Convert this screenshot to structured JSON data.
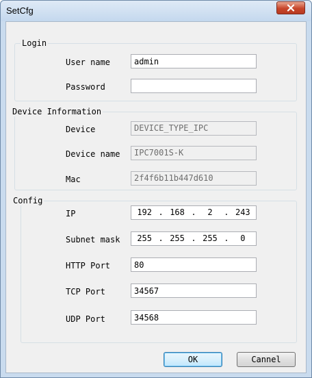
{
  "window": {
    "title": "SetCfg"
  },
  "login": {
    "legend": "Login",
    "username_label": "User name",
    "username_value": "admin",
    "password_label": "Password",
    "password_value": ""
  },
  "device_info": {
    "legend": "Device Information",
    "device_label": "Device",
    "device_value": "DEVICE_TYPE_IPC",
    "device_name_label": "Device name",
    "device_name_value": "IPC7001S-K",
    "mac_label": "Mac",
    "mac_value": "2f4f6b11b447d610"
  },
  "config": {
    "legend": "Config",
    "ip_label": "IP",
    "ip_octets": [
      "192",
      "168",
      "2",
      "243"
    ],
    "subnet_label": "Subnet mask",
    "subnet_octets": [
      "255",
      "255",
      "255",
      "0"
    ],
    "http_port_label": "HTTP Port",
    "http_port_value": "80",
    "tcp_port_label": "TCP Port",
    "tcp_port_value": "34567",
    "udp_port_label": "UDP Port",
    "udp_port_value": "34568",
    "dot": "."
  },
  "buttons": {
    "ok": "OK",
    "cancel": "Cannel"
  },
  "icons": {
    "close": "close-icon"
  }
}
